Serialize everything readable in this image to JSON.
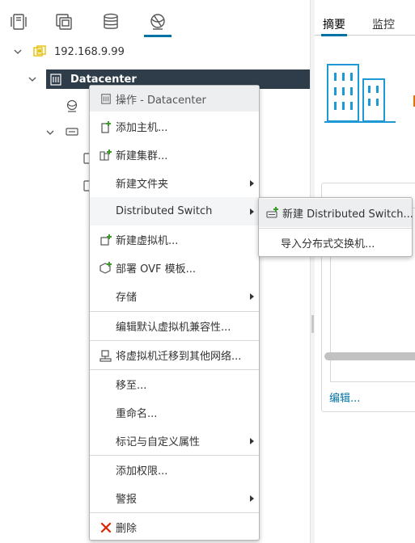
{
  "colors": {
    "accent": "#0072a3",
    "selected_row_bg": "#2e3d49",
    "menu_hover_bg": "#eceef0",
    "delete_red": "#e12200",
    "add_green": "#3d9a2a",
    "folder_yellow": "#e8c317"
  },
  "view_tabs": [
    {
      "icon": "hosts-clusters-icon",
      "active": false
    },
    {
      "icon": "vms-templates-icon",
      "active": false
    },
    {
      "icon": "storage-icon",
      "active": false
    },
    {
      "icon": "networking-icon",
      "active": true
    }
  ],
  "tree": {
    "vcenter": {
      "label": "192.168.9.99",
      "icon": "vcenter-icon"
    },
    "datacenter": {
      "label": "Datacenter",
      "icon": "datacenter-icon"
    }
  },
  "content": {
    "tabs": [
      {
        "label": "摘要",
        "active": true
      },
      {
        "label": "监控",
        "active": false
      }
    ],
    "edit_link": "编辑..."
  },
  "context_menu": {
    "header": {
      "label": "操作 - Datacenter",
      "icon": "actions-icon"
    },
    "items": [
      {
        "label": "添加主机...",
        "icon": "add-host-icon",
        "submenu": false
      },
      {
        "label": "新建集群...",
        "icon": "new-cluster-icon",
        "submenu": false
      },
      {
        "label": "新建文件夹",
        "icon": "",
        "submenu": true
      },
      {
        "label": "Distributed Switch",
        "icon": "",
        "submenu": true
      },
      {
        "label": "新建虚拟机...",
        "icon": "new-vm-icon",
        "submenu": false
      },
      {
        "label": "部署 OVF 模板...",
        "icon": "deploy-ovf-icon",
        "submenu": false
      },
      {
        "label": "存储",
        "icon": "",
        "submenu": true
      },
      {
        "label": "编辑默认虚拟机兼容性...",
        "icon": "",
        "submenu": false
      },
      {
        "label": "将虚拟机迁移到其他网络...",
        "icon": "migrate-vm-network-icon",
        "submenu": false
      },
      {
        "label": "移至...",
        "icon": "",
        "submenu": false
      },
      {
        "label": "重命名...",
        "icon": "",
        "submenu": false
      },
      {
        "label": "标记与自定义属性",
        "icon": "",
        "submenu": true
      },
      {
        "label": "添加权限...",
        "icon": "",
        "submenu": false
      },
      {
        "label": "警报",
        "icon": "",
        "submenu": true
      },
      {
        "label": "删除",
        "icon": "delete-icon",
        "submenu": false
      }
    ]
  },
  "submenu": {
    "items": [
      {
        "label": "新建 Distributed Switch...",
        "icon": "new-dvswitch-icon"
      },
      {
        "label": "导入分布式交换机...",
        "icon": ""
      }
    ]
  }
}
